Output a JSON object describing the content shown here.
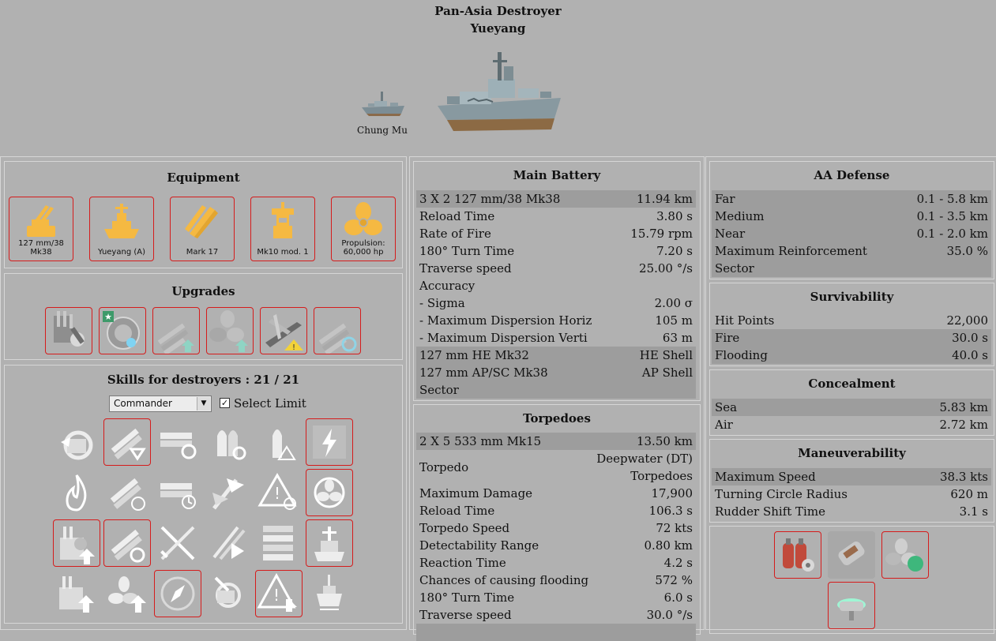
{
  "header": {
    "nation_class": "Pan-Asia Destroyer",
    "ship_name": "Yueyang",
    "previous_ship": "Chung Mu"
  },
  "equipment": {
    "title": "Equipment",
    "items": [
      {
        "label": "127 mm/38 Mk38",
        "icon": "main-battery-icon"
      },
      {
        "label": "Yueyang (A)",
        "icon": "hull-icon"
      },
      {
        "label": "Mark 17",
        "icon": "torpedoes-icon"
      },
      {
        "label": "Mk10 mod. 1",
        "icon": "fire-control-icon"
      },
      {
        "label": "Propulsion:",
        "label2": "60,000 hp",
        "icon": "propulsion-icon"
      }
    ]
  },
  "upgrades": {
    "title": "Upgrades",
    "items": [
      "main-armaments-modification-icon",
      "damage-control-modification-icon",
      "torpedo-tubes-modification-icon",
      "propulsion-modification-icon",
      "aircraft-carrier-spotting-icon",
      "torpedo-reload-modification-icon"
    ]
  },
  "skills": {
    "title": "Skills for destroyers : 21 / 21",
    "commander_select": "Commander",
    "limit_label": "Select Limit",
    "limit_checked": "✓"
  },
  "main_battery": {
    "title": "Main Battery",
    "rows": [
      {
        "k": "3 X 2 127 mm/38 Mk38",
        "v": "11.94 km"
      },
      {
        "k": "Reload Time",
        "v": "3.80 s"
      },
      {
        "k": "Rate of Fire",
        "v": "15.79 rpm"
      },
      {
        "k": "180° Turn Time",
        "v": "7.20 s"
      },
      {
        "k": "Traverse speed",
        "v": "25.00 °/s"
      },
      {
        "k": "Accuracy",
        "v": ""
      },
      {
        "k": "- Sigma",
        "v": "2.00 σ"
      },
      {
        "k": "- Maximum Dispersion Horiz",
        "v": "105 m"
      },
      {
        "k": "- Maximum Dispersion Verti",
        "v": "63 m"
      },
      {
        "k": "127 mm HE Mk32",
        "v": "HE Shell"
      },
      {
        "k": "127 mm AP/SC Mk38",
        "v": "AP Shell"
      },
      {
        "k": "Sector",
        "v": ""
      }
    ]
  },
  "torpedoes": {
    "title": "Torpedoes",
    "rows": [
      {
        "k": "2 X 5 533 mm Mk15",
        "v": "13.50 km"
      },
      {
        "k": "Torpedo",
        "v": "Deepwater (DT)",
        "v2": "Torpedoes"
      },
      {
        "k": "Maximum Damage",
        "v": "17,900"
      },
      {
        "k": "Reload Time",
        "v": "106.3 s"
      },
      {
        "k": "Torpedo Speed",
        "v": "72 kts"
      },
      {
        "k": "Detectability Range",
        "v": "0.80 km"
      },
      {
        "k": "Reaction Time",
        "v": "4.2 s"
      },
      {
        "k": "Chances of causing flooding",
        "v": "572 %"
      },
      {
        "k": "180° Turn Time",
        "v": "6.0 s"
      },
      {
        "k": "Traverse speed",
        "v": "30.0 °/s"
      }
    ]
  },
  "aa_defense": {
    "title": "AA Defense",
    "rows": [
      {
        "k": "Far",
        "v": "0.1 - 5.8 km"
      },
      {
        "k": "Medium",
        "v": "0.1 - 3.5 km"
      },
      {
        "k": "Near",
        "v": "0.1 - 2.0 km"
      },
      {
        "k": "Maximum Reinforcement",
        "v": "35.0 %"
      },
      {
        "k": "Sector",
        "v": ""
      }
    ]
  },
  "survivability": {
    "title": "Survivability",
    "rows": [
      {
        "k": "Hit Points",
        "v": "22,000"
      },
      {
        "k": "Fire",
        "v": "30.0 s"
      },
      {
        "k": "Flooding",
        "v": "40.0 s"
      }
    ]
  },
  "concealment": {
    "title": "Concealment",
    "rows": [
      {
        "k": "Sea",
        "v": "5.83 km"
      },
      {
        "k": "Air",
        "v": "2.72 km"
      }
    ]
  },
  "maneuverability": {
    "title": "Maneuverability",
    "rows": [
      {
        "k": "Maximum Speed",
        "v": "38.3 kts"
      },
      {
        "k": "Turning Circle Radius",
        "v": "620 m"
      },
      {
        "k": "Rudder Shift Time",
        "v": "3.1 s"
      }
    ]
  },
  "consumables": [
    "damage-control-party-icon",
    "smoke-generator-icon",
    "engine-boost-icon",
    "hydroacoustic-search-icon"
  ],
  "colors": {
    "background": "#b1b1b1",
    "stripe": "#9d9d9d",
    "selected_border": "#d51c1c",
    "equipment_icon": "#f5b942"
  }
}
